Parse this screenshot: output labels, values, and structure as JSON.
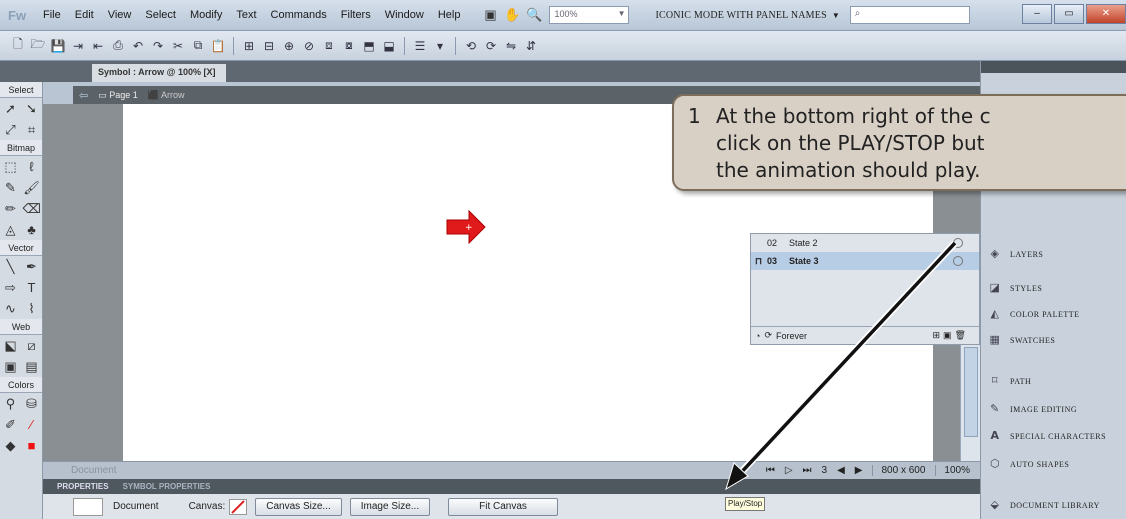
{
  "app": {
    "logo": "Fw"
  },
  "menu": [
    "File",
    "Edit",
    "View",
    "Select",
    "Modify",
    "Text",
    "Commands",
    "Filters",
    "Window",
    "Help"
  ],
  "toolbar": {
    "zoom": "100%",
    "workspace_mode": "ICONIC MODE WITH PANEL NAMES",
    "workspace_arrow": "▼"
  },
  "document_tab": {
    "label": "Symbol : Arrow @ 100% [X]"
  },
  "breadcrumb": {
    "page": "Page 1",
    "symbol": "Arrow"
  },
  "tools": {
    "sections": [
      "Select",
      "Bitmap",
      "Vector",
      "Web",
      "Colors"
    ]
  },
  "frames": {
    "rows": [
      {
        "num": "02",
        "name": "State 2",
        "selected": false
      },
      {
        "num": "03",
        "name": "State 3",
        "selected": true
      }
    ],
    "loop_label": "Forever"
  },
  "status": {
    "document_name": "Document",
    "frame_number": "3",
    "canvas_size": "800 x 600",
    "zoom": "100%"
  },
  "properties": {
    "tab_properties": "PROPERTIES",
    "tab_symbol": "SYMBOL PROPERTIES",
    "doc_label": "Document",
    "canvas_label": "Canvas:",
    "canvas_size_btn": "Canvas Size...",
    "image_size_btn": "Image Size...",
    "fit_canvas_btn": "Fit Canvas"
  },
  "dock": {
    "items": [
      {
        "label": "LAYERS",
        "icon": "layers-icon"
      },
      {
        "label": "STYLES",
        "icon": "styles-icon"
      },
      {
        "label": "COLOR PALETTE",
        "icon": "palette-icon"
      },
      {
        "label": "SWATCHES",
        "icon": "swatches-icon"
      },
      {
        "label": "PATH",
        "icon": "path-icon"
      },
      {
        "label": "IMAGE EDITING",
        "icon": "image-editing-icon"
      },
      {
        "label": "SPECIAL CHARACTERS",
        "icon": "special-characters-icon"
      },
      {
        "label": "AUTO SHAPES",
        "icon": "auto-shapes-icon"
      },
      {
        "label": "DOCUMENT LIBRARY",
        "icon": "document-library-icon"
      }
    ]
  },
  "callout": {
    "number": "1",
    "line1": "At the bottom right of the c",
    "line2": "click on the PLAY/STOP but",
    "line3": "the animation should play."
  },
  "tooltip": "Play/Stop",
  "colors": {
    "arrow_symbol": "#e01a1a",
    "callout_bg": "#d9d0c5"
  }
}
